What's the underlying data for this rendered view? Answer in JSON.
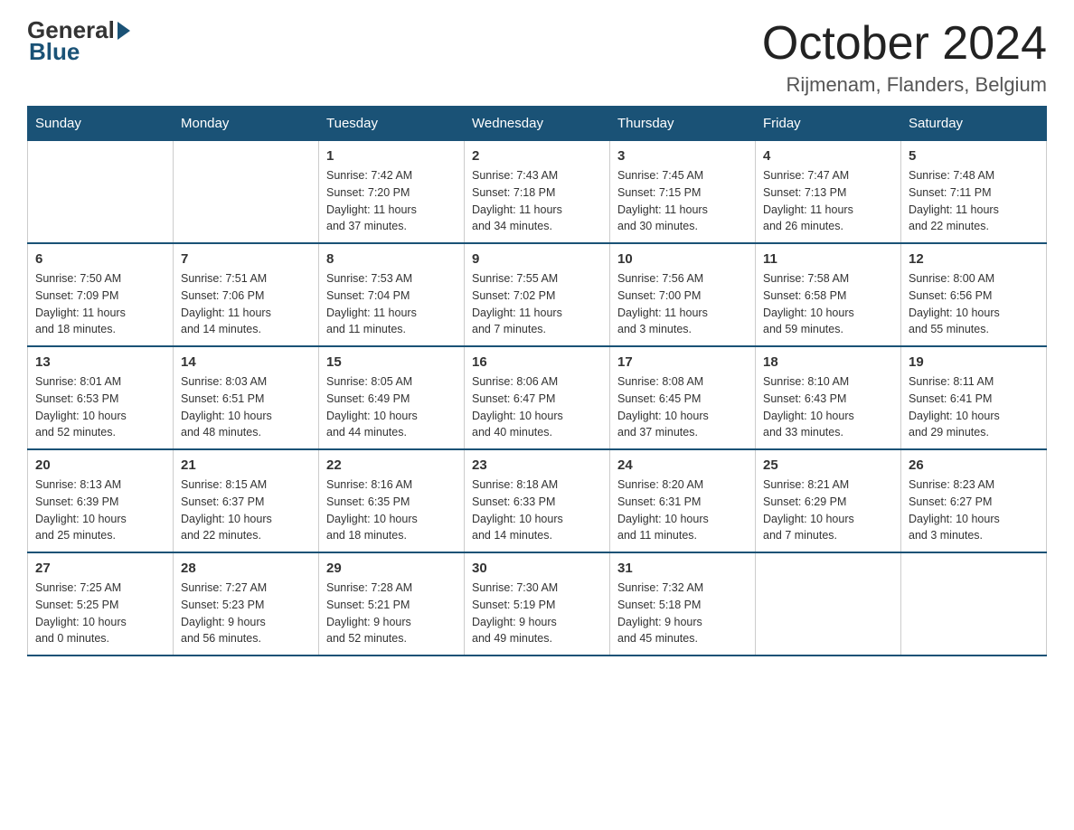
{
  "logo": {
    "general": "General",
    "blue": "Blue"
  },
  "title": "October 2024",
  "location": "Rijmenam, Flanders, Belgium",
  "days_of_week": [
    "Sunday",
    "Monday",
    "Tuesday",
    "Wednesday",
    "Thursday",
    "Friday",
    "Saturday"
  ],
  "weeks": [
    [
      {
        "day": "",
        "info": ""
      },
      {
        "day": "",
        "info": ""
      },
      {
        "day": "1",
        "info": "Sunrise: 7:42 AM\nSunset: 7:20 PM\nDaylight: 11 hours\nand 37 minutes."
      },
      {
        "day": "2",
        "info": "Sunrise: 7:43 AM\nSunset: 7:18 PM\nDaylight: 11 hours\nand 34 minutes."
      },
      {
        "day": "3",
        "info": "Sunrise: 7:45 AM\nSunset: 7:15 PM\nDaylight: 11 hours\nand 30 minutes."
      },
      {
        "day": "4",
        "info": "Sunrise: 7:47 AM\nSunset: 7:13 PM\nDaylight: 11 hours\nand 26 minutes."
      },
      {
        "day": "5",
        "info": "Sunrise: 7:48 AM\nSunset: 7:11 PM\nDaylight: 11 hours\nand 22 minutes."
      }
    ],
    [
      {
        "day": "6",
        "info": "Sunrise: 7:50 AM\nSunset: 7:09 PM\nDaylight: 11 hours\nand 18 minutes."
      },
      {
        "day": "7",
        "info": "Sunrise: 7:51 AM\nSunset: 7:06 PM\nDaylight: 11 hours\nand 14 minutes."
      },
      {
        "day": "8",
        "info": "Sunrise: 7:53 AM\nSunset: 7:04 PM\nDaylight: 11 hours\nand 11 minutes."
      },
      {
        "day": "9",
        "info": "Sunrise: 7:55 AM\nSunset: 7:02 PM\nDaylight: 11 hours\nand 7 minutes."
      },
      {
        "day": "10",
        "info": "Sunrise: 7:56 AM\nSunset: 7:00 PM\nDaylight: 11 hours\nand 3 minutes."
      },
      {
        "day": "11",
        "info": "Sunrise: 7:58 AM\nSunset: 6:58 PM\nDaylight: 10 hours\nand 59 minutes."
      },
      {
        "day": "12",
        "info": "Sunrise: 8:00 AM\nSunset: 6:56 PM\nDaylight: 10 hours\nand 55 minutes."
      }
    ],
    [
      {
        "day": "13",
        "info": "Sunrise: 8:01 AM\nSunset: 6:53 PM\nDaylight: 10 hours\nand 52 minutes."
      },
      {
        "day": "14",
        "info": "Sunrise: 8:03 AM\nSunset: 6:51 PM\nDaylight: 10 hours\nand 48 minutes."
      },
      {
        "day": "15",
        "info": "Sunrise: 8:05 AM\nSunset: 6:49 PM\nDaylight: 10 hours\nand 44 minutes."
      },
      {
        "day": "16",
        "info": "Sunrise: 8:06 AM\nSunset: 6:47 PM\nDaylight: 10 hours\nand 40 minutes."
      },
      {
        "day": "17",
        "info": "Sunrise: 8:08 AM\nSunset: 6:45 PM\nDaylight: 10 hours\nand 37 minutes."
      },
      {
        "day": "18",
        "info": "Sunrise: 8:10 AM\nSunset: 6:43 PM\nDaylight: 10 hours\nand 33 minutes."
      },
      {
        "day": "19",
        "info": "Sunrise: 8:11 AM\nSunset: 6:41 PM\nDaylight: 10 hours\nand 29 minutes."
      }
    ],
    [
      {
        "day": "20",
        "info": "Sunrise: 8:13 AM\nSunset: 6:39 PM\nDaylight: 10 hours\nand 25 minutes."
      },
      {
        "day": "21",
        "info": "Sunrise: 8:15 AM\nSunset: 6:37 PM\nDaylight: 10 hours\nand 22 minutes."
      },
      {
        "day": "22",
        "info": "Sunrise: 8:16 AM\nSunset: 6:35 PM\nDaylight: 10 hours\nand 18 minutes."
      },
      {
        "day": "23",
        "info": "Sunrise: 8:18 AM\nSunset: 6:33 PM\nDaylight: 10 hours\nand 14 minutes."
      },
      {
        "day": "24",
        "info": "Sunrise: 8:20 AM\nSunset: 6:31 PM\nDaylight: 10 hours\nand 11 minutes."
      },
      {
        "day": "25",
        "info": "Sunrise: 8:21 AM\nSunset: 6:29 PM\nDaylight: 10 hours\nand 7 minutes."
      },
      {
        "day": "26",
        "info": "Sunrise: 8:23 AM\nSunset: 6:27 PM\nDaylight: 10 hours\nand 3 minutes."
      }
    ],
    [
      {
        "day": "27",
        "info": "Sunrise: 7:25 AM\nSunset: 5:25 PM\nDaylight: 10 hours\nand 0 minutes."
      },
      {
        "day": "28",
        "info": "Sunrise: 7:27 AM\nSunset: 5:23 PM\nDaylight: 9 hours\nand 56 minutes."
      },
      {
        "day": "29",
        "info": "Sunrise: 7:28 AM\nSunset: 5:21 PM\nDaylight: 9 hours\nand 52 minutes."
      },
      {
        "day": "30",
        "info": "Sunrise: 7:30 AM\nSunset: 5:19 PM\nDaylight: 9 hours\nand 49 minutes."
      },
      {
        "day": "31",
        "info": "Sunrise: 7:32 AM\nSunset: 5:18 PM\nDaylight: 9 hours\nand 45 minutes."
      },
      {
        "day": "",
        "info": ""
      },
      {
        "day": "",
        "info": ""
      }
    ]
  ]
}
